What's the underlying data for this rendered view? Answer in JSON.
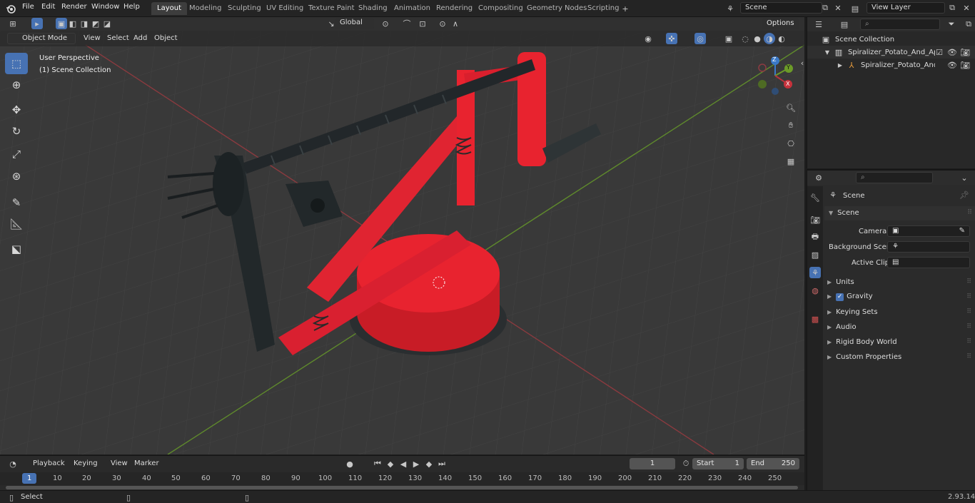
{
  "menu": {
    "file": "File",
    "edit": "Edit",
    "render": "Render",
    "window": "Window",
    "help": "Help"
  },
  "workspaces": [
    {
      "label": "Layout",
      "active": true
    },
    {
      "label": "Modeling"
    },
    {
      "label": "Sculpting"
    },
    {
      "label": "UV Editing"
    },
    {
      "label": "Texture Paint"
    },
    {
      "label": "Shading"
    },
    {
      "label": "Animation"
    },
    {
      "label": "Rendering"
    },
    {
      "label": "Compositing"
    },
    {
      "label": "Geometry Nodes"
    },
    {
      "label": "Scripting"
    }
  ],
  "scene_field": "Scene",
  "view_layer_field": "View Layer",
  "header": {
    "mode": "Object Mode",
    "view": "View",
    "select": "Select",
    "add": "Add",
    "object": "Object",
    "transform_orientation": "Global",
    "options": "Options"
  },
  "viewport": {
    "perspective": "User Perspective",
    "collection": "(1) Scene Collection",
    "gizmo": {
      "x": "X",
      "y": "Y",
      "z": "Z"
    }
  },
  "outliner": {
    "root": "Scene Collection",
    "item1": "Spiralizer_Potato_And_Apple_",
    "item2": "Spiralizer_Potato_And_Ap"
  },
  "properties": {
    "title": "Scene",
    "section": "Scene",
    "camera_label": "Camera",
    "background_label": "Background Scene",
    "active_clip_label": "Active Clip",
    "panels": [
      "Units",
      "Gravity",
      "Keying Sets",
      "Audio",
      "Rigid Body World",
      "Custom Properties"
    ],
    "gravity_checked": true
  },
  "timeline": {
    "playback": "Playback",
    "keying": "Keying",
    "view": "View",
    "marker": "Marker",
    "current_frame": "1",
    "start_label": "Start",
    "start": "1",
    "end_label": "End",
    "end": "250",
    "ruler": [
      "1",
      "10",
      "20",
      "30",
      "40",
      "50",
      "60",
      "70",
      "80",
      "90",
      "100",
      "110",
      "120",
      "130",
      "140",
      "150",
      "160",
      "170",
      "180",
      "190",
      "200",
      "210",
      "220",
      "230",
      "240",
      "250"
    ]
  },
  "status": {
    "select": "Select",
    "version": "2.93.14"
  },
  "colors": {
    "accent": "#4772b3",
    "object_red": "#e8222f",
    "x_axis": "#a8343c",
    "y_axis": "#6c9b28"
  }
}
